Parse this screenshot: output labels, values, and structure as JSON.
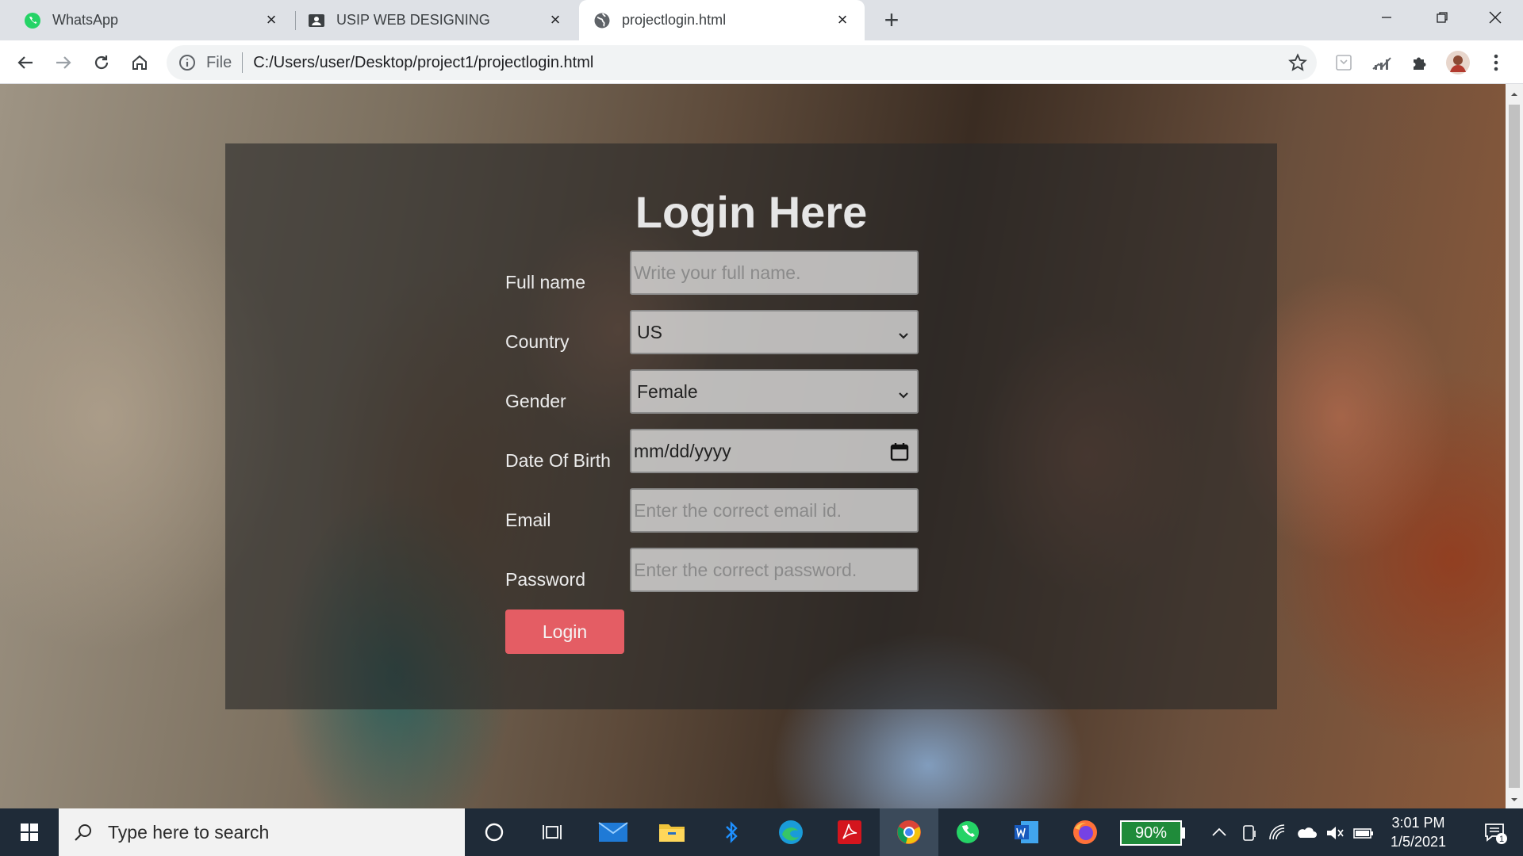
{
  "browser": {
    "tabs": [
      {
        "title": "WhatsApp",
        "icon": "whatsapp-icon"
      },
      {
        "title": "USIP WEB DESIGNING",
        "icon": "contact-card-icon"
      },
      {
        "title": "projectlogin.html",
        "icon": "globe-icon",
        "active": true
      }
    ],
    "address": {
      "scheme_label": "File",
      "url": "C:/Users/user/Desktop/project1/projectlogin.html"
    }
  },
  "page": {
    "title": "Login Here",
    "fields": {
      "full_name": {
        "label": "Full name",
        "placeholder": "Write your full name."
      },
      "country": {
        "label": "Country",
        "value": "US"
      },
      "gender": {
        "label": "Gender",
        "value": "Female"
      },
      "dob": {
        "label": "Date Of Birth",
        "placeholder": "mm/dd/yyyy"
      },
      "email": {
        "label": "Email",
        "placeholder": "Enter the correct email id."
      },
      "password": {
        "label": "Password",
        "placeholder": "Enter the correct password."
      }
    },
    "login_button": "Login",
    "colors": {
      "panel": "#282828",
      "button": "#e45d64"
    }
  },
  "taskbar": {
    "search_placeholder": "Type here to search",
    "battery": "90%",
    "time": "3:01 PM",
    "date": "1/5/2021",
    "notification_count": "1"
  }
}
